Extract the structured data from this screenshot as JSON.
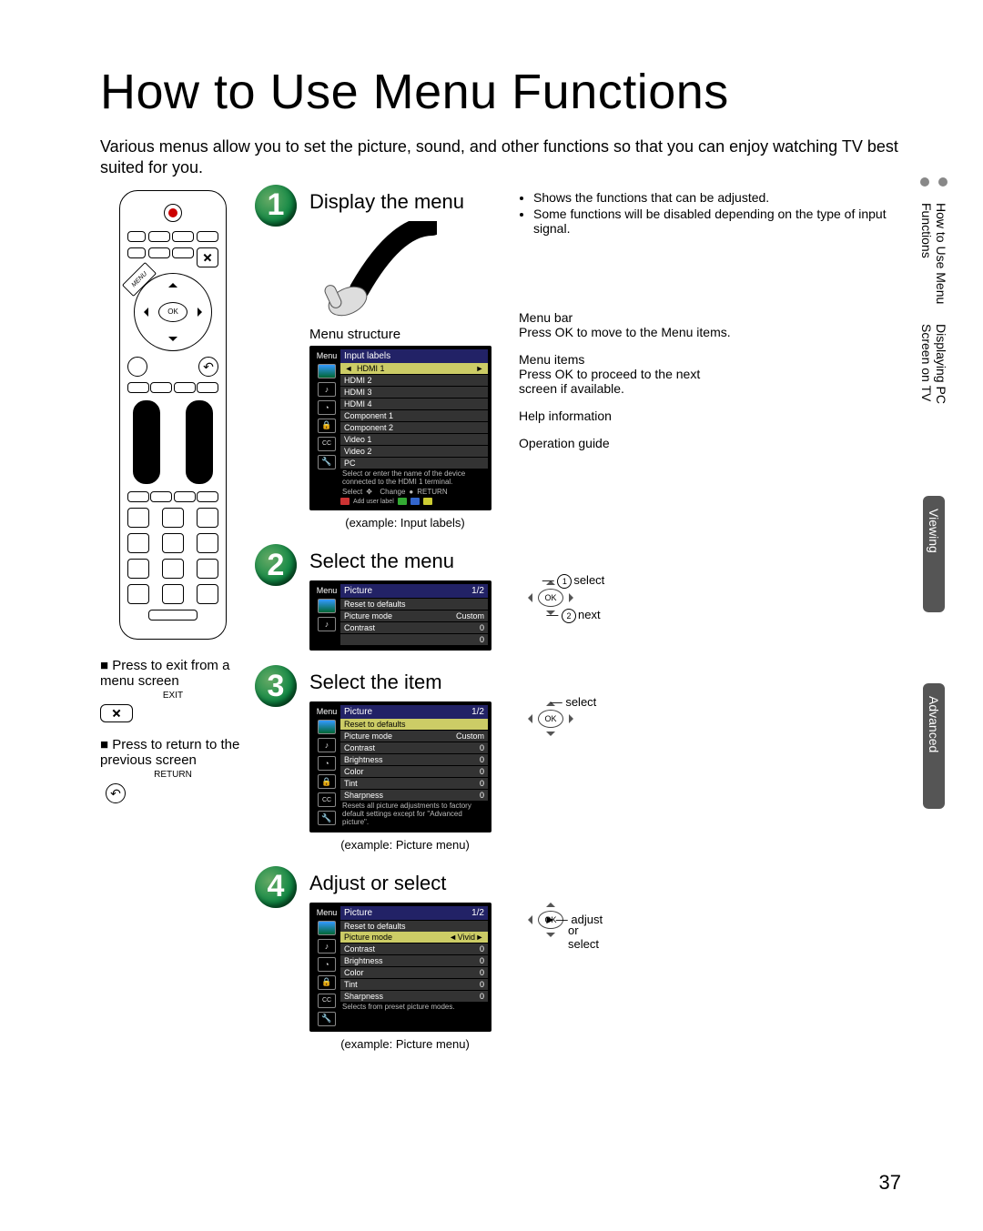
{
  "page_number": "37",
  "title": "How to Use Menu Functions",
  "intro": "Various menus allow you to set the picture, sound, and other functions so that you can enjoy watching TV best suited for you.",
  "side_tabs": {
    "t1a": "How to Use Menu Functions",
    "t1b": "Displaying PC Screen on TV",
    "t2": "Viewing",
    "t3": "Advanced"
  },
  "remote": {
    "menu_label": "MENU",
    "ok_label": "OK"
  },
  "left_notes": {
    "exit_title": "Press to exit from a menu screen",
    "exit_label": "EXIT",
    "return_title": "Press to return to the previous screen",
    "return_label": "RETURN"
  },
  "step1": {
    "num": "1",
    "title": "Display the menu",
    "bullets": [
      "Shows the functions that can be adjusted.",
      "Some functions will be disabled depending on the type of input signal."
    ],
    "structure_label": "Menu structure",
    "menu_header": "Menu",
    "menu_title": "Input labels",
    "highlight": "HDMI 1",
    "items": [
      "HDMI 2",
      "HDMI 3",
      "HDMI 4",
      "Component 1",
      "Component 2",
      "Video 1",
      "Video 2",
      "PC"
    ],
    "help": "Select or enter the name of the device connected to the HDMI 1 terminal.",
    "guide_select": "Select",
    "guide_change": "Change",
    "guide_return": "RETURN",
    "guide_add": "Add user label",
    "example": "(example: Input labels)",
    "callouts": {
      "menubar_t": "Menu bar",
      "menubar_d": "Press OK to move to the Menu items.",
      "items_t": "Menu items",
      "items_d1": "Press OK to proceed to the next",
      "items_d2": "screen if available.",
      "help_t": "Help information",
      "op_t": "Operation guide"
    }
  },
  "step2": {
    "num": "2",
    "title": "Select the menu",
    "menu_header": "Menu",
    "menu_title": "Picture",
    "menu_page": "1/2",
    "rows": [
      {
        "l": "Reset to defaults",
        "v": ""
      },
      {
        "l": "Picture mode",
        "v": "Custom"
      },
      {
        "l": "Contrast",
        "v": "0"
      },
      {
        "l": "",
        "v": "0"
      }
    ],
    "nav": {
      "select": "select",
      "next": "next",
      "b1": "1",
      "b2": "2"
    }
  },
  "step3": {
    "num": "3",
    "title": "Select the item",
    "menu_header": "Menu",
    "menu_title": "Picture",
    "menu_page": "1/2",
    "rows": [
      {
        "l": "Reset to defaults",
        "v": ""
      },
      {
        "l": "Picture mode",
        "v": "Custom"
      },
      {
        "l": "Contrast",
        "v": "0"
      },
      {
        "l": "Brightness",
        "v": "0"
      },
      {
        "l": "Color",
        "v": "0"
      },
      {
        "l": "Tint",
        "v": "0"
      },
      {
        "l": "Sharpness",
        "v": "0"
      }
    ],
    "help": "Resets all picture adjustments to factory default settings except for \"Advanced picture\".",
    "example": "(example:  Picture menu)",
    "nav": {
      "select": "select"
    }
  },
  "step4": {
    "num": "4",
    "title": "Adjust or select",
    "menu_header": "Menu",
    "menu_title": "Picture",
    "menu_page": "1/2",
    "rows_pre": {
      "l": "Reset to defaults",
      "v": ""
    },
    "highlight": {
      "l": "Picture mode",
      "v": "Vivid"
    },
    "rows": [
      {
        "l": "Contrast",
        "v": "0"
      },
      {
        "l": "Brightness",
        "v": "0"
      },
      {
        "l": "Color",
        "v": "0"
      },
      {
        "l": "Tint",
        "v": "0"
      },
      {
        "l": "Sharpness",
        "v": "0"
      }
    ],
    "help": "Selects from preset picture modes.",
    "example": "(example:  Picture menu)",
    "nav": {
      "adjust": "adjust",
      "or": "or",
      "select": "select"
    }
  }
}
